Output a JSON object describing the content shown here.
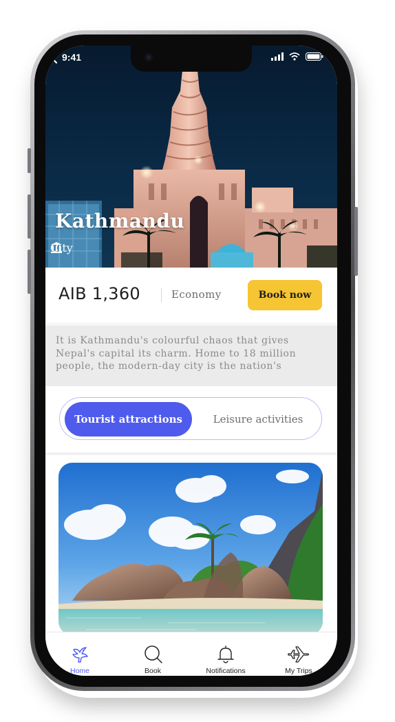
{
  "status_bar": {
    "time": "9:41"
  },
  "hero": {
    "title": "Kathmandu",
    "subtitle": "City",
    "subtitle_icon": "landmark-icon",
    "back_icon": "chevron-left-icon"
  },
  "booking": {
    "price": "AIB 1,360",
    "class_label": "Economy",
    "book_button": "Book now"
  },
  "description": "It is Kathmandu's colourful chaos that gives Nepal's capital its charm. Home to 18 million people, the modern-day city is the nation's",
  "tabs": [
    {
      "label": "Tourist attractions",
      "active": true
    },
    {
      "label": "Leisure activities",
      "active": false
    }
  ],
  "bottom_nav": [
    {
      "label": "Home",
      "icon": "bird-icon",
      "active": true
    },
    {
      "label": "Book",
      "icon": "search-icon",
      "active": false
    },
    {
      "label": "Notifications",
      "icon": "bell-icon",
      "active": false
    },
    {
      "label": "My Trips",
      "icon": "airplane-icon",
      "active": false
    }
  ],
  "colors": {
    "accent": "#4f5bed",
    "book_button": "#f6c533",
    "description_bg": "#ebebeb"
  }
}
